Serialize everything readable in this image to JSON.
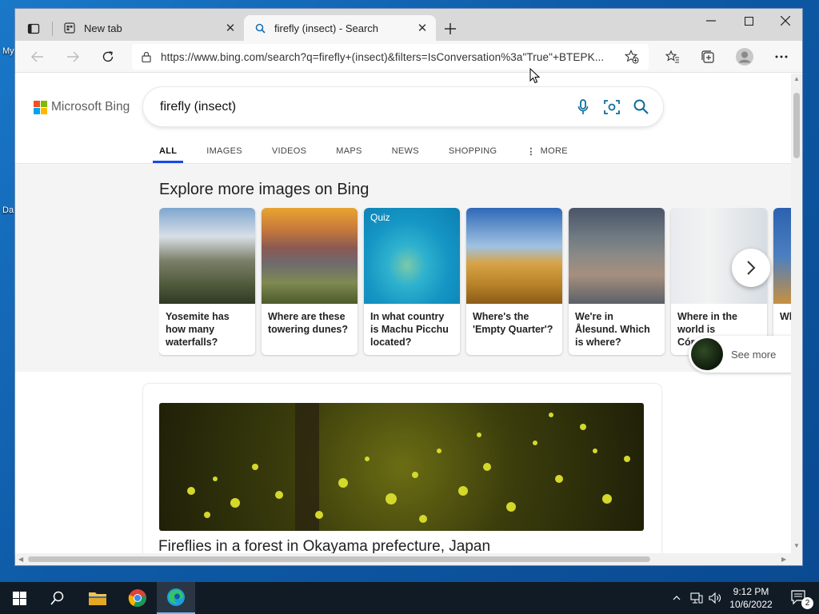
{
  "desktop": {
    "icons": [
      "My",
      "Da"
    ]
  },
  "browser": {
    "tabs": [
      {
        "title": "New tab",
        "icon": "new-tab-icon"
      },
      {
        "title": "firefly (insect) - Search",
        "icon": "search-icon"
      }
    ],
    "url": "https://www.bing.com/search?q=firefly+(insect)&filters=IsConversation%3a\"True\"+BTEPK..."
  },
  "bing": {
    "logo_text": "Microsoft Bing",
    "query": "firefly (insect)",
    "nav_tabs": [
      "ALL",
      "IMAGES",
      "VIDEOS",
      "MAPS",
      "NEWS",
      "SHOPPING",
      "MORE"
    ],
    "active_tab": "ALL",
    "explore_title": "Explore more images on Bing",
    "cards": [
      {
        "caption": "Yosemite has how many waterfalls?",
        "badge": ""
      },
      {
        "caption": "Where are these towering dunes?",
        "badge": ""
      },
      {
        "caption": "In what country is Machu Picchu located?",
        "badge": "Quiz"
      },
      {
        "caption": "Where's the 'Empty Quarter'?",
        "badge": ""
      },
      {
        "caption": "We're in Ålesund. Which is where?",
        "badge": ""
      },
      {
        "caption": "Where in the world is Córdoba?",
        "badge": ""
      },
      {
        "caption": "Wh an po",
        "badge": ""
      }
    ],
    "result_title": "Fireflies in a forest in Okayama prefecture, Japan",
    "see_more": "See more"
  },
  "taskbar": {
    "time": "9:12 PM",
    "date": "10/6/2022",
    "notifications": "2"
  },
  "colors": {
    "bing_accent": "#174ae4",
    "ms_red": "#f25022",
    "ms_green": "#7fba00",
    "ms_blue": "#00a4ef",
    "ms_yellow": "#ffb900",
    "search_teal": "#0f6e9c"
  }
}
